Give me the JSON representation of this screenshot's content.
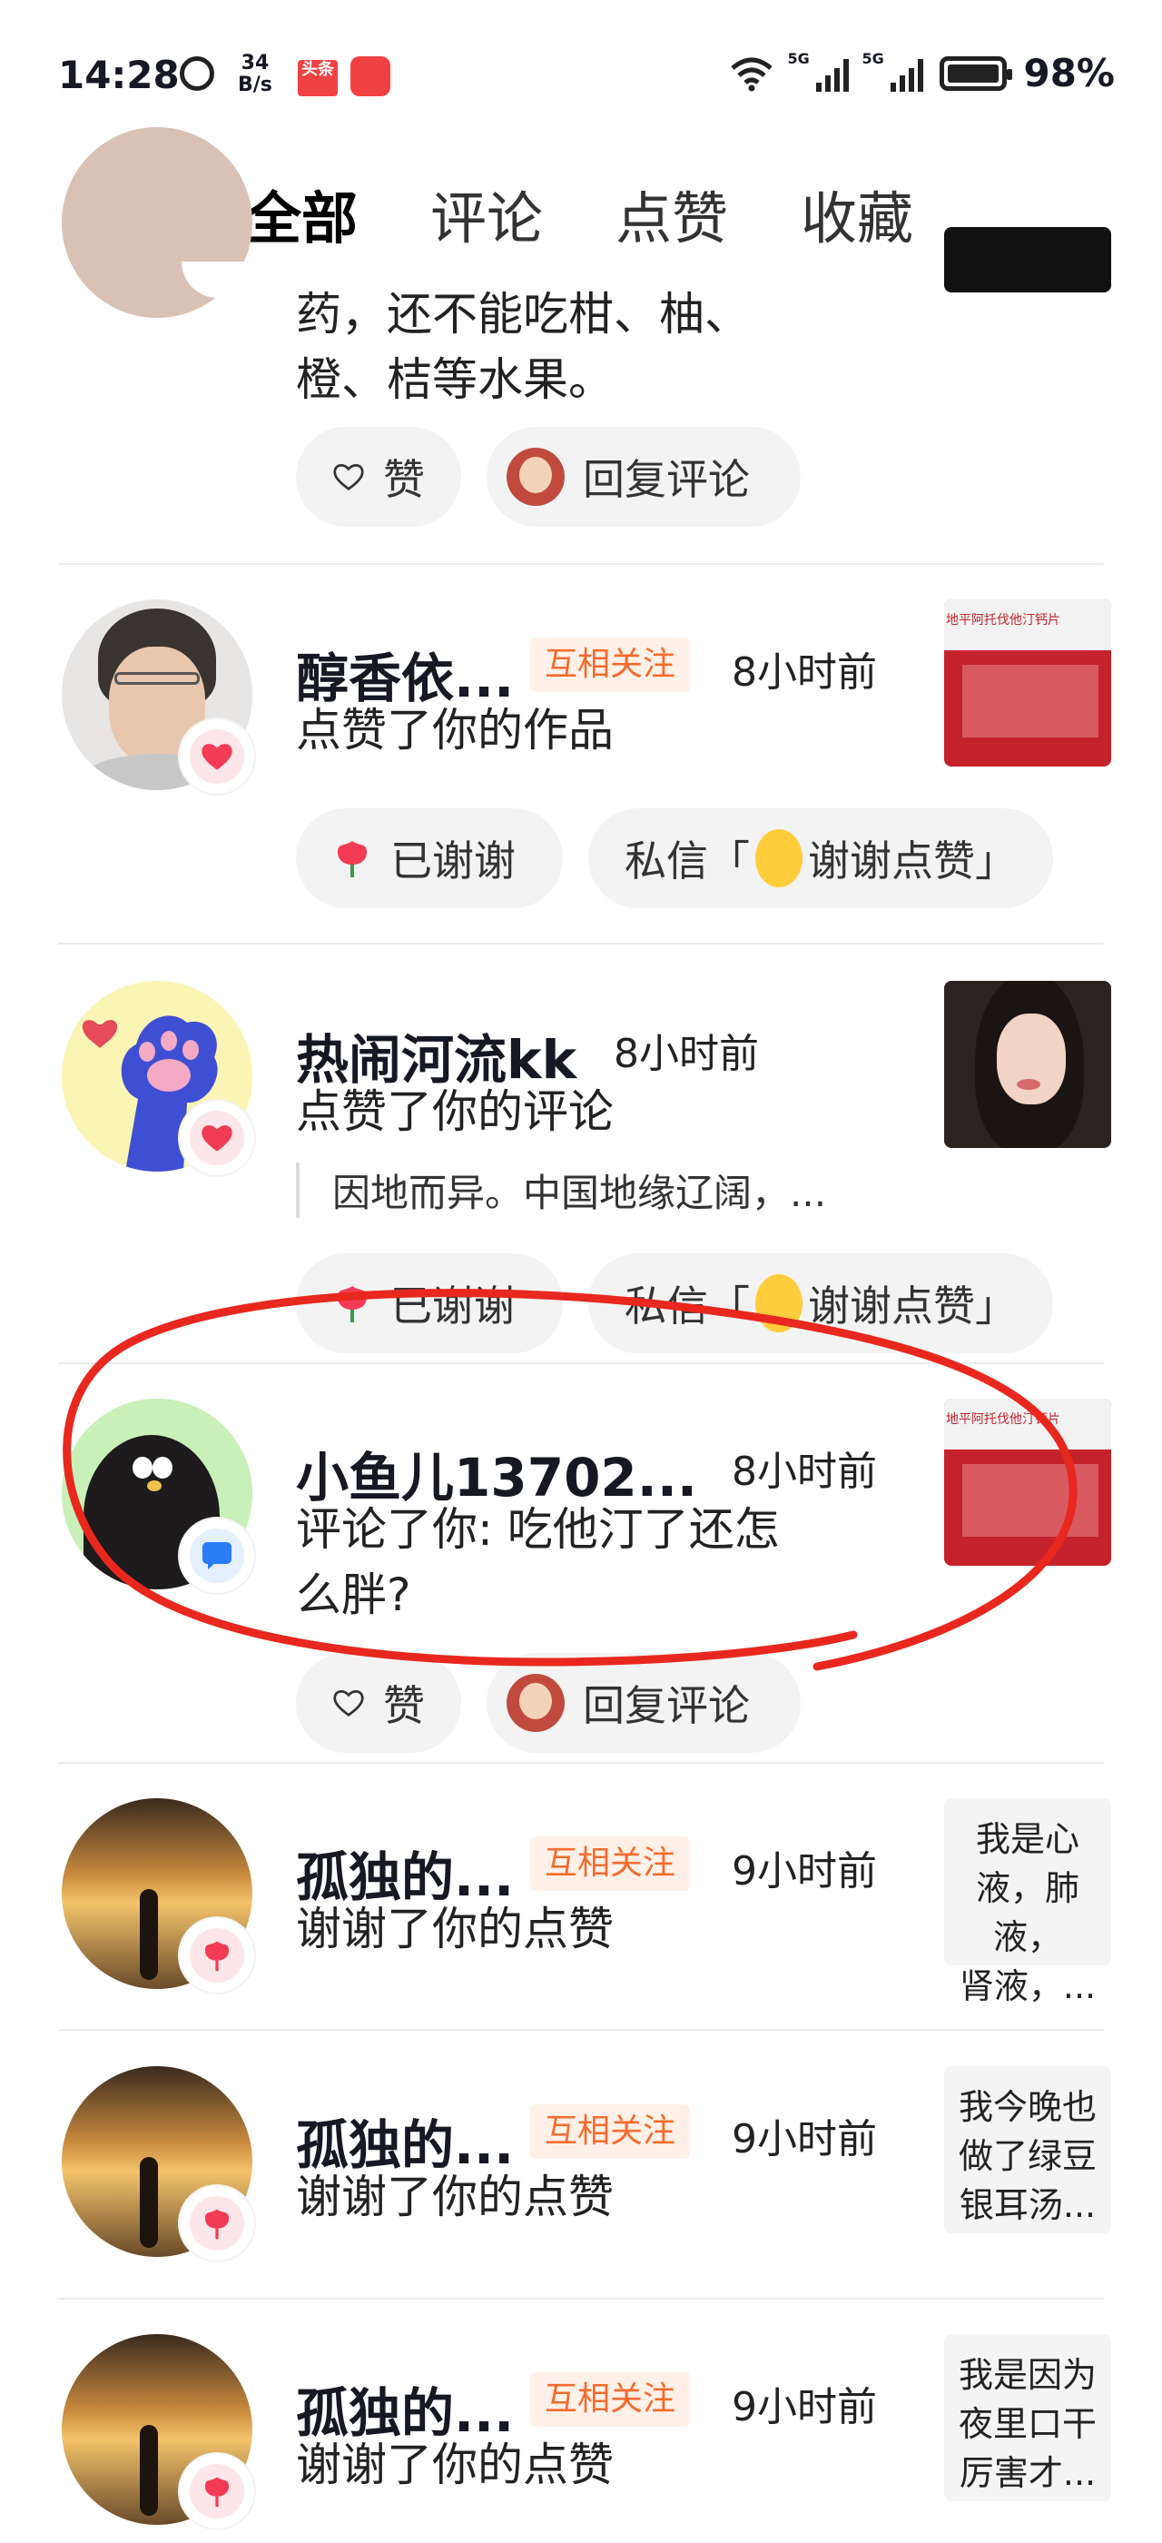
{
  "status_bar": {
    "time": "14:28",
    "net_speed_top": "34",
    "net_speed_unit": "B/s",
    "app_icon_1": "头条",
    "signal_1_label": "5G",
    "signal_2_label": "5G",
    "battery": "98%"
  },
  "nav": {
    "tabs": [
      {
        "label": "全部",
        "active": true
      },
      {
        "label": "评论",
        "active": false
      },
      {
        "label": "点赞",
        "active": false
      },
      {
        "label": "收藏",
        "active": false
      }
    ]
  },
  "items": [
    {
      "partial": true,
      "action_lines": [
        "药，还不能吃柑、柚、",
        "橙、桔等水果。"
      ],
      "buttons": {
        "like": "赞",
        "reply": "回复评论"
      }
    },
    {
      "name": "醇香依...",
      "mutual": "互相关注",
      "time": "8小时前",
      "action": "点赞了你的作品",
      "thumb_caption": "地平阿托伐他汀钙片",
      "buttons": {
        "thanked": "已谢谢",
        "dm": "私信「",
        "dm_text": "谢谢点赞」"
      }
    },
    {
      "name": "热闹河流kk",
      "time": "8小时前",
      "action": "点赞了你的评论",
      "quote": "因地而异。中国地缘辽阔，...",
      "buttons": {
        "thanked": "已谢谢",
        "dm": "私信「",
        "dm_text": "谢谢点赞」"
      }
    },
    {
      "name": "小鱼儿13702...",
      "time": "8小时前",
      "action_lines": [
        "评论了你: 吃他汀了还怎",
        "么胖?"
      ],
      "thumb_caption": "地平阿托伐他汀钙片",
      "buttons": {
        "like": "赞",
        "reply": "回复评论"
      }
    },
    {
      "name": "孤独的...",
      "mutual": "互相关注",
      "time": "9小时前",
      "action": "谢谢了你的点赞",
      "thumb_lines": [
        "我是心",
        "液，肺液，",
        "肾液，..."
      ]
    },
    {
      "name": "孤独的...",
      "mutual": "互相关注",
      "time": "9小时前",
      "action": "谢谢了你的点赞",
      "thumb_lines": [
        "我今晚也",
        "做了绿豆",
        "银耳汤..."
      ]
    },
    {
      "name": "孤独的...",
      "mutual": "互相关注",
      "time": "9小时前",
      "action": "谢谢了你的点赞",
      "thumb_lines": [
        "我是因为",
        "夜里口干",
        "厉害才..."
      ]
    }
  ],
  "colors": {
    "accent_orange": "#f46b2e",
    "like_red": "#f23b55",
    "annotation_red": "#e8281e"
  }
}
